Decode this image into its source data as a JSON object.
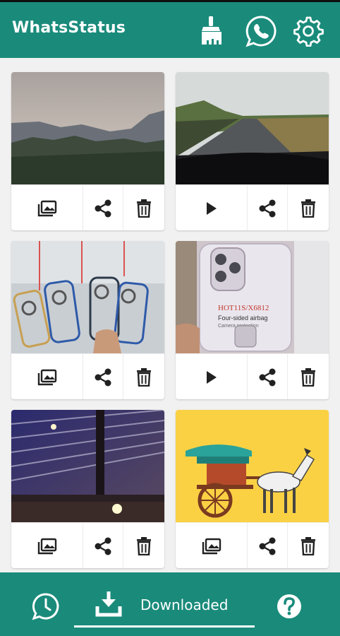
{
  "app": {
    "title": "WhatsStatus"
  },
  "toolbar": {
    "icons": [
      "broom-icon",
      "whatsapp-icon",
      "gear-icon"
    ]
  },
  "statuses": [
    {
      "type": "image",
      "thumbnail": "mountain-sunset",
      "actions": [
        "gallery-icon",
        "share-icon",
        "trash-icon"
      ]
    },
    {
      "type": "video",
      "thumbnail": "rainy-road",
      "actions": [
        "play-icon",
        "share-icon",
        "trash-icon"
      ]
    },
    {
      "type": "image",
      "thumbnail": "phone-cases",
      "actions": [
        "gallery-icon",
        "share-icon",
        "trash-icon"
      ]
    },
    {
      "type": "video",
      "thumbnail": "clear-phone-case",
      "caption": "HOT11S/X6812",
      "caption2": "Four-sided airbag",
      "caption3": "Camera protection",
      "actions": [
        "play-icon",
        "share-icon",
        "trash-icon"
      ]
    },
    {
      "type": "image",
      "thumbnail": "roof-structure",
      "actions": [
        "gallery-icon",
        "share-icon",
        "trash-icon"
      ]
    },
    {
      "type": "image",
      "thumbnail": "horse-carriage",
      "actions": [
        "gallery-icon",
        "share-icon",
        "trash-icon"
      ]
    }
  ],
  "bottom_nav": {
    "status_icon": "whatsapp-clock-icon",
    "downloaded_label": "Downloaded",
    "downloaded_icon": "download-icon",
    "help_icon": "help-icon"
  },
  "colors": {
    "primary": "#1a8b7b",
    "background": "#f1f1f1",
    "icon": "#212121"
  }
}
